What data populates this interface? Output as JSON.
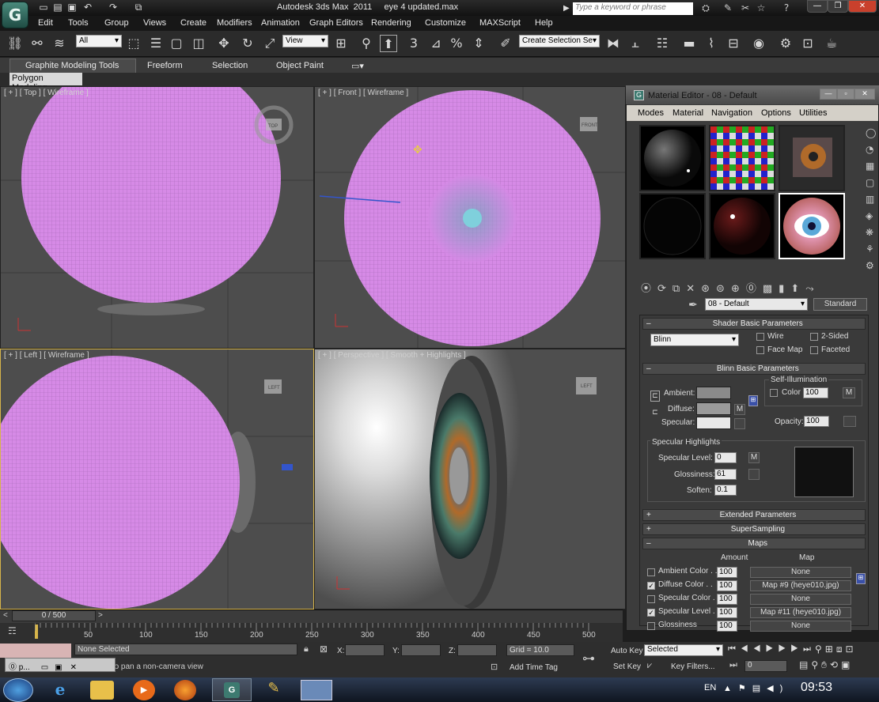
{
  "title_bar": {
    "app_name": "Autodesk 3ds Max  2011",
    "file_name": "eye 4 updated.max",
    "search_placeholder": "Type a keyword or phrase",
    "logo_letter": "G"
  },
  "menus": [
    "Edit",
    "Tools",
    "Group",
    "Views",
    "Create",
    "Modifiers",
    "Animation",
    "Graph Editors",
    "Rendering",
    "Customize",
    "MAXScript",
    "Help"
  ],
  "toolbar": {
    "selection_filter": "All",
    "reference_coord": "View",
    "named_selection": "Create Selection Se",
    "snap_number": "3"
  },
  "ribbon": {
    "tabs": [
      "Graphite Modeling Tools",
      "Freeform",
      "Selection",
      "Object Paint"
    ],
    "sub_tab": "Polygon Modeling"
  },
  "viewports": {
    "top": "[ + ] [ Top ] [ Wireframe ]",
    "front": "[ + ] [ Front ] [ Wireframe ]",
    "left": "[ + ] [ Left ] [ Wireframe ]",
    "perspective": "[ + ] [ Perspective ] [ Smooth + Highlights ]",
    "viewcube_top": "TOP",
    "viewcube_front": "FRONT",
    "viewcube_left": "LEFT",
    "viewcube_persp": "LEFT"
  },
  "material_editor": {
    "title": "Material Editor - 08 - Default",
    "menus": [
      "Modes",
      "Material",
      "Navigation",
      "Options",
      "Utilities"
    ],
    "material_name": "08 - Default",
    "material_type": "Standard",
    "shader_rollout": "Shader Basic Parameters",
    "shader": "Blinn",
    "wire": "Wire",
    "two_sided": "2-Sided",
    "face_map": "Face Map",
    "faceted": "Faceted",
    "blinn_rollout": "Blinn Basic Parameters",
    "self_illum": "Self-Illumination",
    "color_label": "Color",
    "color_value": "100",
    "ambient": "Ambient:",
    "diffuse": "Diffuse:",
    "specular": "Specular:",
    "opacity_label": "Opacity:",
    "opacity_value": "100",
    "m_button": "M",
    "spec_highlights": "Specular Highlights",
    "spec_level_label": "Specular Level:",
    "spec_level": "0",
    "gloss_label": "Glossiness:",
    "gloss": "61",
    "soften_label": "Soften:",
    "soften": "0.1",
    "extended": "Extended Parameters",
    "supersampling": "SuperSampling",
    "maps": "Maps",
    "amount_hdr": "Amount",
    "map_hdr": "Map",
    "map_rows": [
      {
        "label": "Ambient Color . .",
        "amount": "100",
        "map": "None",
        "checked": false
      },
      {
        "label": "Diffuse Color . .",
        "amount": "100",
        "map": "Map #9 (heye010.jpg)",
        "checked": true
      },
      {
        "label": "Specular Color . .",
        "amount": "100",
        "map": "None",
        "checked": false
      },
      {
        "label": "Specular Level .",
        "amount": "100",
        "map": "Map #11 (heye010.jpg)",
        "checked": true
      },
      {
        "label": "Glossiness",
        "amount": "100",
        "map": "None",
        "checked": false
      }
    ]
  },
  "timeline": {
    "frame": "0 / 500",
    "ticks": [
      "50",
      "100",
      "150",
      "200",
      "250",
      "300",
      "350",
      "400",
      "450",
      "500"
    ]
  },
  "status": {
    "selection": "None Selected",
    "prompt": "Click-drag to pan a non-camera view",
    "x_label": "X:",
    "y_label": "Y:",
    "z_label": "Z:",
    "grid": "Grid = 10.0",
    "add_time_tag": "Add Time Tag",
    "auto_key": "Auto Key",
    "set_key": "Set Key",
    "key_mode": "Selected",
    "key_filters": "Key Filters...",
    "frame_value": "0",
    "p_label": "p..."
  },
  "taskbar": {
    "lang": "EN",
    "clock": "09:53"
  },
  "colors": {
    "wire": "#d888e8",
    "viewport_bg": "#4d4d4d",
    "active_border": "#d6b44a"
  }
}
